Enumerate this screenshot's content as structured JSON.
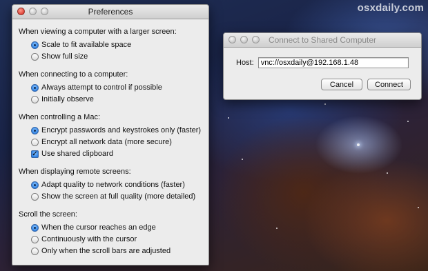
{
  "watermark": "osxdaily.com",
  "preferences": {
    "title": "Preferences",
    "sections": [
      {
        "title": "When viewing a computer with a larger screen:",
        "options": [
          {
            "label": "Scale to fit available space",
            "selected": true
          },
          {
            "label": "Show full size",
            "selected": false
          }
        ]
      },
      {
        "title": "When connecting to a computer:",
        "options": [
          {
            "label": "Always attempt to control if possible",
            "selected": true
          },
          {
            "label": "Initially observe",
            "selected": false
          }
        ]
      },
      {
        "title": "When controlling a Mac:",
        "options": [
          {
            "label": "Encrypt passwords and keystrokes only (faster)",
            "selected": true
          },
          {
            "label": "Encrypt all network data (more secure)",
            "selected": false
          }
        ],
        "checkbox": {
          "label": "Use shared clipboard",
          "checked": true
        }
      },
      {
        "title": "When displaying remote screens:",
        "options": [
          {
            "label": "Adapt quality to network conditions (faster)",
            "selected": true
          },
          {
            "label": "Show the screen at full quality (more detailed)",
            "selected": false
          }
        ]
      },
      {
        "title": "Scroll the screen:",
        "options": [
          {
            "label": "When the cursor reaches an edge",
            "selected": true
          },
          {
            "label": "Continuously with the cursor",
            "selected": false
          },
          {
            "label": "Only when the scroll bars are adjusted",
            "selected": false
          }
        ]
      }
    ]
  },
  "connect": {
    "title": "Connect to Shared Computer",
    "host_label": "Host:",
    "host_value": "vnc://osxdaily@192.168.1.48",
    "cancel_label": "Cancel",
    "connect_label": "Connect"
  }
}
